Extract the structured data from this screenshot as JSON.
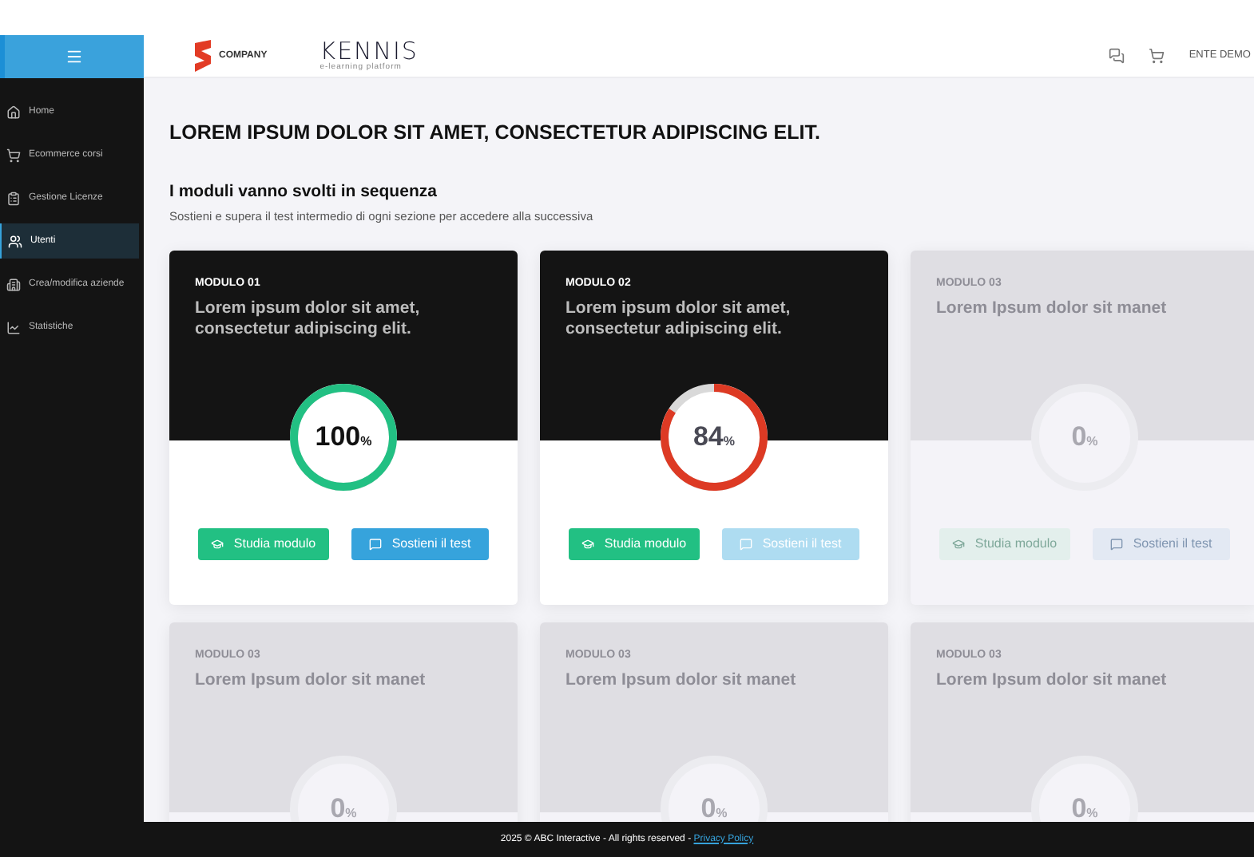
{
  "sidebar": {
    "items": [
      {
        "label": "Home",
        "selected": false
      },
      {
        "label": "Ecommerce corsi",
        "selected": false
      },
      {
        "label": "Gestione Licenze",
        "selected": false
      },
      {
        "label": "Utenti",
        "selected": true
      },
      {
        "label": "Crea/modifica aziende",
        "selected": false
      },
      {
        "label": "Statistiche",
        "selected": false
      }
    ]
  },
  "header": {
    "company_logo": "COMPANY",
    "brand_logo": "KENNIS",
    "brand_tagline": "e-learning platform",
    "user": "ENTE DEMO"
  },
  "page": {
    "title": "LOREM IPSUM DOLOR SIT AMET, CONSECTETUR ADIPISCING ELIT.",
    "section_title": "I moduli vanno svolti in sequenza",
    "section_subtitle": "Sostieni e supera il test intermedio di ogni sezione per accedere alla successiva"
  },
  "modules": [
    {
      "label": "MODULO 01",
      "title": "Lorem ipsum dolor sit amet, consectetur adipiscing elit.",
      "percent": "100",
      "unit": "%",
      "level": 1,
      "color": "#22c083",
      "locked": false,
      "buttons": [
        {
          "kind": "study",
          "label": "Studia modulo",
          "disabled": false
        },
        {
          "kind": "test",
          "label": "Sostieni il test",
          "disabled": false
        }
      ]
    },
    {
      "label": "MODULO 02",
      "title": "Lorem ipsum dolor sit amet, consectetur adipiscing elit.",
      "percent": "84",
      "unit": "%",
      "level": 0.84,
      "color": "#dd3a24",
      "locked": false,
      "buttons": [
        {
          "kind": "study",
          "label": "Studia modulo",
          "disabled": false
        },
        {
          "kind": "test",
          "label": "Sostieni il test",
          "disabled": true
        }
      ]
    },
    {
      "label": "MODULO 03",
      "title": "Lorem Ipsum dolor sit manet",
      "percent": "0",
      "unit": "%",
      "locked": true,
      "buttons": [
        {
          "kind": "study",
          "label": "Studia modulo",
          "disabled": true
        },
        {
          "kind": "test",
          "label": "Sostieni il test",
          "disabled": true
        }
      ]
    },
    {
      "label": "MODULO 03",
      "title": "Lorem Ipsum dolor sit manet",
      "percent": "0",
      "unit": "%",
      "locked": true
    },
    {
      "label": "MODULO 03",
      "title": "Lorem Ipsum dolor sit manet",
      "percent": "0",
      "unit": "%",
      "locked": true
    },
    {
      "label": "MODULO 03",
      "title": "Lorem Ipsum dolor sit manet",
      "percent": "0",
      "unit": "%",
      "locked": true
    }
  ],
  "footer": {
    "text": "2025 © ABC Interactive - All rights reserved - ",
    "link": "Privacy Policy"
  }
}
